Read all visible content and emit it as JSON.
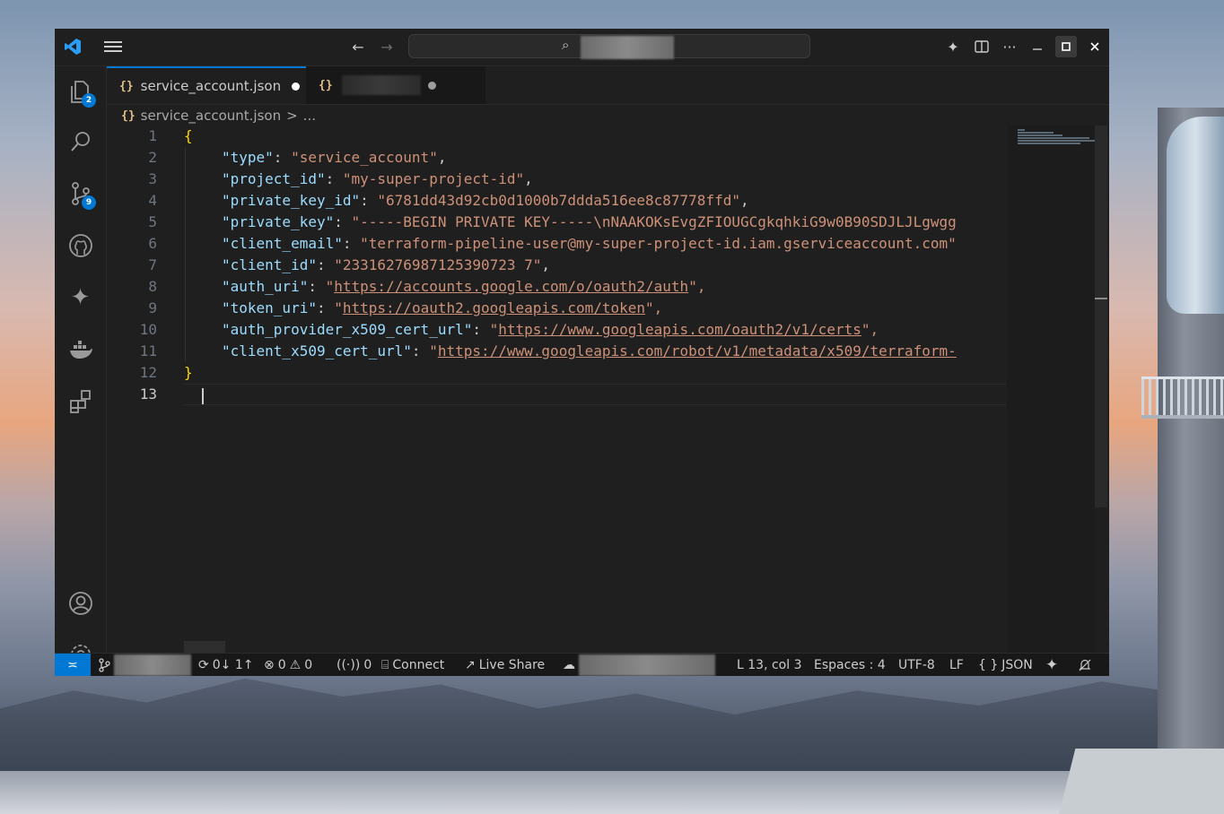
{
  "window": {
    "title_icons": [
      "vscode-logo-icon",
      "menu-icon"
    ],
    "nav": {
      "back": "←",
      "forward": "→"
    }
  },
  "activity_bar": {
    "explorer_badge": "2",
    "source_control_badge": "9"
  },
  "tabs": [
    {
      "label": "service_account.json",
      "icon": "{}",
      "modified": true
    },
    {
      "label": "",
      "icon": "{}",
      "modified": true
    }
  ],
  "breadcrumb": {
    "file": "service_account.json",
    "separator": ">",
    "more": "..."
  },
  "editor": {
    "line_numbers": [
      "1",
      "2",
      "3",
      "4",
      "5",
      "6",
      "7",
      "8",
      "9",
      "10",
      "11",
      "12",
      "13"
    ],
    "current_line": "13",
    "lines": [
      {
        "key": "\"type\"",
        "value": "\"service_account\"",
        "tail": ","
      },
      {
        "key": "\"project_id\"",
        "value": "\"my-super-project-id\"",
        "tail": ","
      },
      {
        "key": "\"private_key_id\"",
        "value": "\"6781dd43d92cb0d1000b7ddda516ee8c87778ffd\"",
        "tail": ","
      },
      {
        "key": "\"private_key\"",
        "value": "\"-----BEGIN PRIVATE KEY-----\\nNAAKOKsEvgZFIOUGCgkqhkiG9w0B90SDJLJLgwgg",
        "tail": ""
      },
      {
        "key": "\"client_email\"",
        "value": "\"terraform-pipeline-user@my-super-project-id.iam.gserviceaccount.com\"",
        "tail": ""
      },
      {
        "key": "\"client_id\"",
        "value": "\"23316276987125390723 7\"",
        "tail": ","
      },
      {
        "key": "\"auth_uri\"",
        "q": "\"",
        "url": "https://accounts.google.com/o/oauth2/auth",
        "tail": "\","
      },
      {
        "key": "\"token_uri\"",
        "q": "\"",
        "url": "https://oauth2.googleapis.com/token",
        "tail": "\","
      },
      {
        "key": "\"auth_provider_x509_cert_url\"",
        "q": "\"",
        "url": "https://www.googleapis.com/oauth2/v1/certs",
        "tail": "\","
      },
      {
        "key": "\"client_x509_cert_url\"",
        "q": "\"",
        "url": "https://www.googleapis.com/robot/v1/metadata/x509/terraform-",
        "tail": ""
      }
    ],
    "open_brace": "{",
    "close_brace": "}"
  },
  "statusbar": {
    "remote_icon": "remote-icon",
    "sync": "0↓ 1↑",
    "errors": "0",
    "warnings": "0",
    "ports": "0",
    "connect": "Connect",
    "live_share": "Live Share",
    "position": "L 13, col 3",
    "indent": "Espaces : 4",
    "encoding": "UTF-8",
    "eol": "LF",
    "language": "JSON"
  },
  "colors": {
    "accent": "#0078d4",
    "key": "#9cdcfe",
    "string": "#ce9178",
    "brace": "#ffd700",
    "json_icon": "#e2c08d"
  }
}
